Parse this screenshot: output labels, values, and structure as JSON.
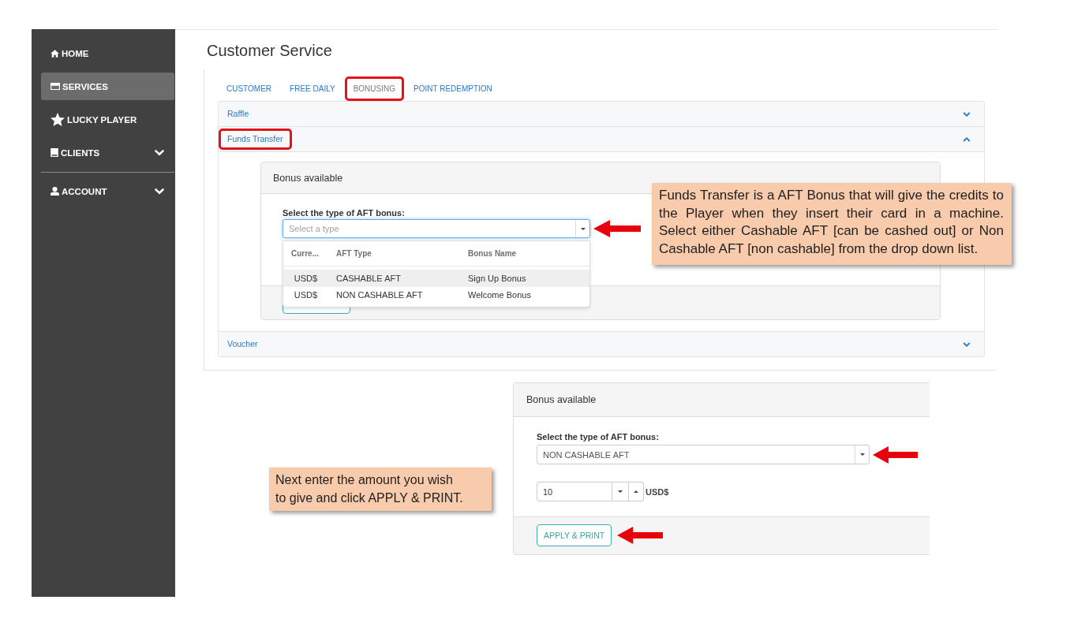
{
  "sidebar": {
    "sections": [
      {
        "items": [
          {
            "label": "HOME",
            "selected": false,
            "expandable": false
          },
          {
            "label": "SERVICES",
            "selected": true,
            "expandable": false
          },
          {
            "label": "LUCKY PLAYER",
            "selected": false,
            "expandable": false
          },
          {
            "label": "CLIENTS",
            "selected": false,
            "expandable": true
          }
        ]
      },
      {
        "items": [
          {
            "label": "ACCOUNT",
            "selected": false,
            "expandable": true
          }
        ]
      }
    ]
  },
  "page": {
    "title": "Customer Service"
  },
  "tabs": [
    {
      "label": "CUSTOMER",
      "selected": false,
      "highlighted": false
    },
    {
      "label": "FREE DAILY",
      "selected": false,
      "highlighted": false
    },
    {
      "label": "BONUSING",
      "selected": true,
      "highlighted": true
    },
    {
      "label": "POINT REDEMPTION",
      "selected": false,
      "highlighted": false
    }
  ],
  "accordion": [
    {
      "title": "Raffle",
      "expanded": false,
      "highlighted": false
    },
    {
      "title": "Funds Transfer",
      "expanded": true,
      "highlighted": true,
      "panel": {
        "title": "Bonus available",
        "field_label": "Select the type of AFT bonus:",
        "select": {
          "placeholder": "Select a type",
          "focused": true,
          "pointer_arrow": true
        },
        "dropdown": {
          "columns": [
            "Curre...",
            "AFT Type",
            "Bonus Name"
          ],
          "rows": [
            {
              "cells": [
                "USD$",
                "CASHABLE AFT",
                "Sign Up Bonus"
              ],
              "selected": true
            },
            {
              "cells": [
                "USD$",
                "NON CASHABLE AFT",
                "Welcome Bonus"
              ],
              "selected": false
            }
          ]
        },
        "callout": "Funds Transfer is a AFT Bonus that will give the credits to the Player when they insert their card in a machine. Select either Cashable AFT [can be cashed out] or Non Cashable AFT [non cashable] from the drop down list."
      }
    },
    {
      "title": "Voucher",
      "expanded": false,
      "highlighted": false
    }
  ],
  "next_step": {
    "callout": "Next enter the amount you wish\nto give and click APPLY & PRINT.",
    "panel": {
      "title": "Bonus available",
      "field_label": "Select the type of AFT bonus:",
      "select": {
        "value": "NON CASHABLE AFT",
        "focused": false,
        "pointer_arrow": true
      },
      "amount": {
        "value": "10",
        "unit": "USD$"
      },
      "button": {
        "label": "APPLY & PRINT",
        "pointer_arrow": true
      }
    }
  }
}
